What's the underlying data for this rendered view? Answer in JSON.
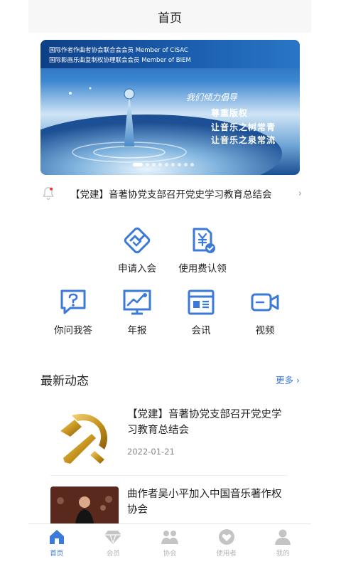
{
  "header": {
    "title": "首页"
  },
  "banner": {
    "line1": "国际作者作曲者协会联合会会员 Member of CISAC",
    "line2": "国际影画乐曲复制权协理联会会员 Member of BIEM",
    "slogan1": "我们倾力倡导",
    "slogan2": "尊重版权",
    "slogan3": "让音乐之树常青",
    "slogan4": "让音乐之泉常流",
    "active_index": 0,
    "slide_count": 9
  },
  "notice": {
    "text": "【党建】音著协党支部召开党史学习教育总结会"
  },
  "shortcuts_row1": [
    {
      "label": "申请入会",
      "icon": "handshake-icon"
    },
    {
      "label": "使用费认领",
      "icon": "yen-document-icon"
    }
  ],
  "shortcuts_row2": [
    {
      "label": "你问我答",
      "icon": "question-bubble-icon"
    },
    {
      "label": "年报",
      "icon": "monitor-chart-icon"
    },
    {
      "label": "会讯",
      "icon": "news-card-icon"
    },
    {
      "label": "视频",
      "icon": "video-camera-icon"
    }
  ],
  "news_section": {
    "title": "最新动态",
    "more": "更多 ›"
  },
  "news": [
    {
      "title": "【党建】音著协党支部召开党史学习教育总结会",
      "date": "2022-01-21"
    },
    {
      "title": "曲作者吴小平加入中国音乐著作权协会"
    }
  ],
  "tabs": [
    {
      "label": "首页",
      "icon": "home-icon",
      "active": true
    },
    {
      "label": "会员",
      "icon": "diamond-icon",
      "active": false
    },
    {
      "label": "协会",
      "icon": "group-icon",
      "active": false
    },
    {
      "label": "使用者",
      "icon": "heart-icon",
      "active": false
    },
    {
      "label": "我的",
      "icon": "user-icon",
      "active": false
    }
  ],
  "colors": {
    "accent": "#3b7ad9",
    "tab_inactive": "#b5b5b5"
  }
}
